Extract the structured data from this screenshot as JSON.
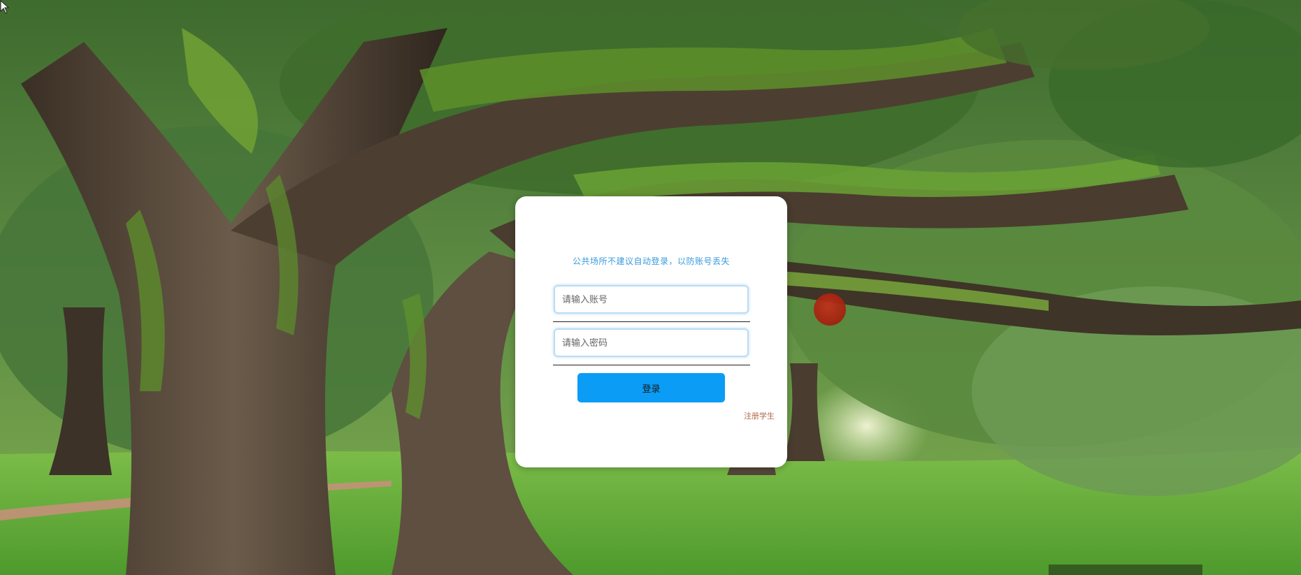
{
  "login": {
    "notice": "公共场所不建议自动登录，以防账号丢失",
    "account_placeholder": "请输入账号",
    "password_placeholder": "请输入密码",
    "login_button": "登录",
    "register_link": "注册学生"
  },
  "colors": {
    "accent": "#0b9cf5",
    "notice_text": "#3a9bdc",
    "link_text": "#b06a4a",
    "card_background": "#ffffff"
  },
  "icons": {
    "pointer": "mouse-cursor-icon"
  }
}
